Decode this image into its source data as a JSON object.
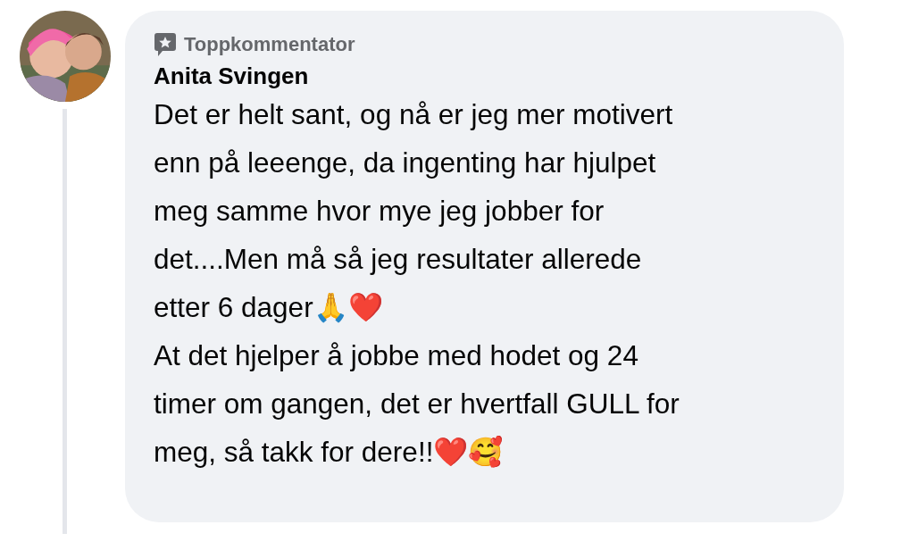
{
  "comment": {
    "badge": "Toppkommentator",
    "author": "Anita Svingen",
    "paragraphs": [
      "Det er helt sant, og nå er jeg mer motivert\nenn på leeenge, da ingenting har hjulpet\nmeg samme hvor mye jeg jobber for\ndet....Men må så jeg resultater allerede\netter 6 dager🙏❤️",
      "At det hjelper å jobbe med hodet og 24\ntimer om gangen, det er hvertfall GULL for\nmeg, så takk for dere!!❤️🥰"
    ]
  }
}
